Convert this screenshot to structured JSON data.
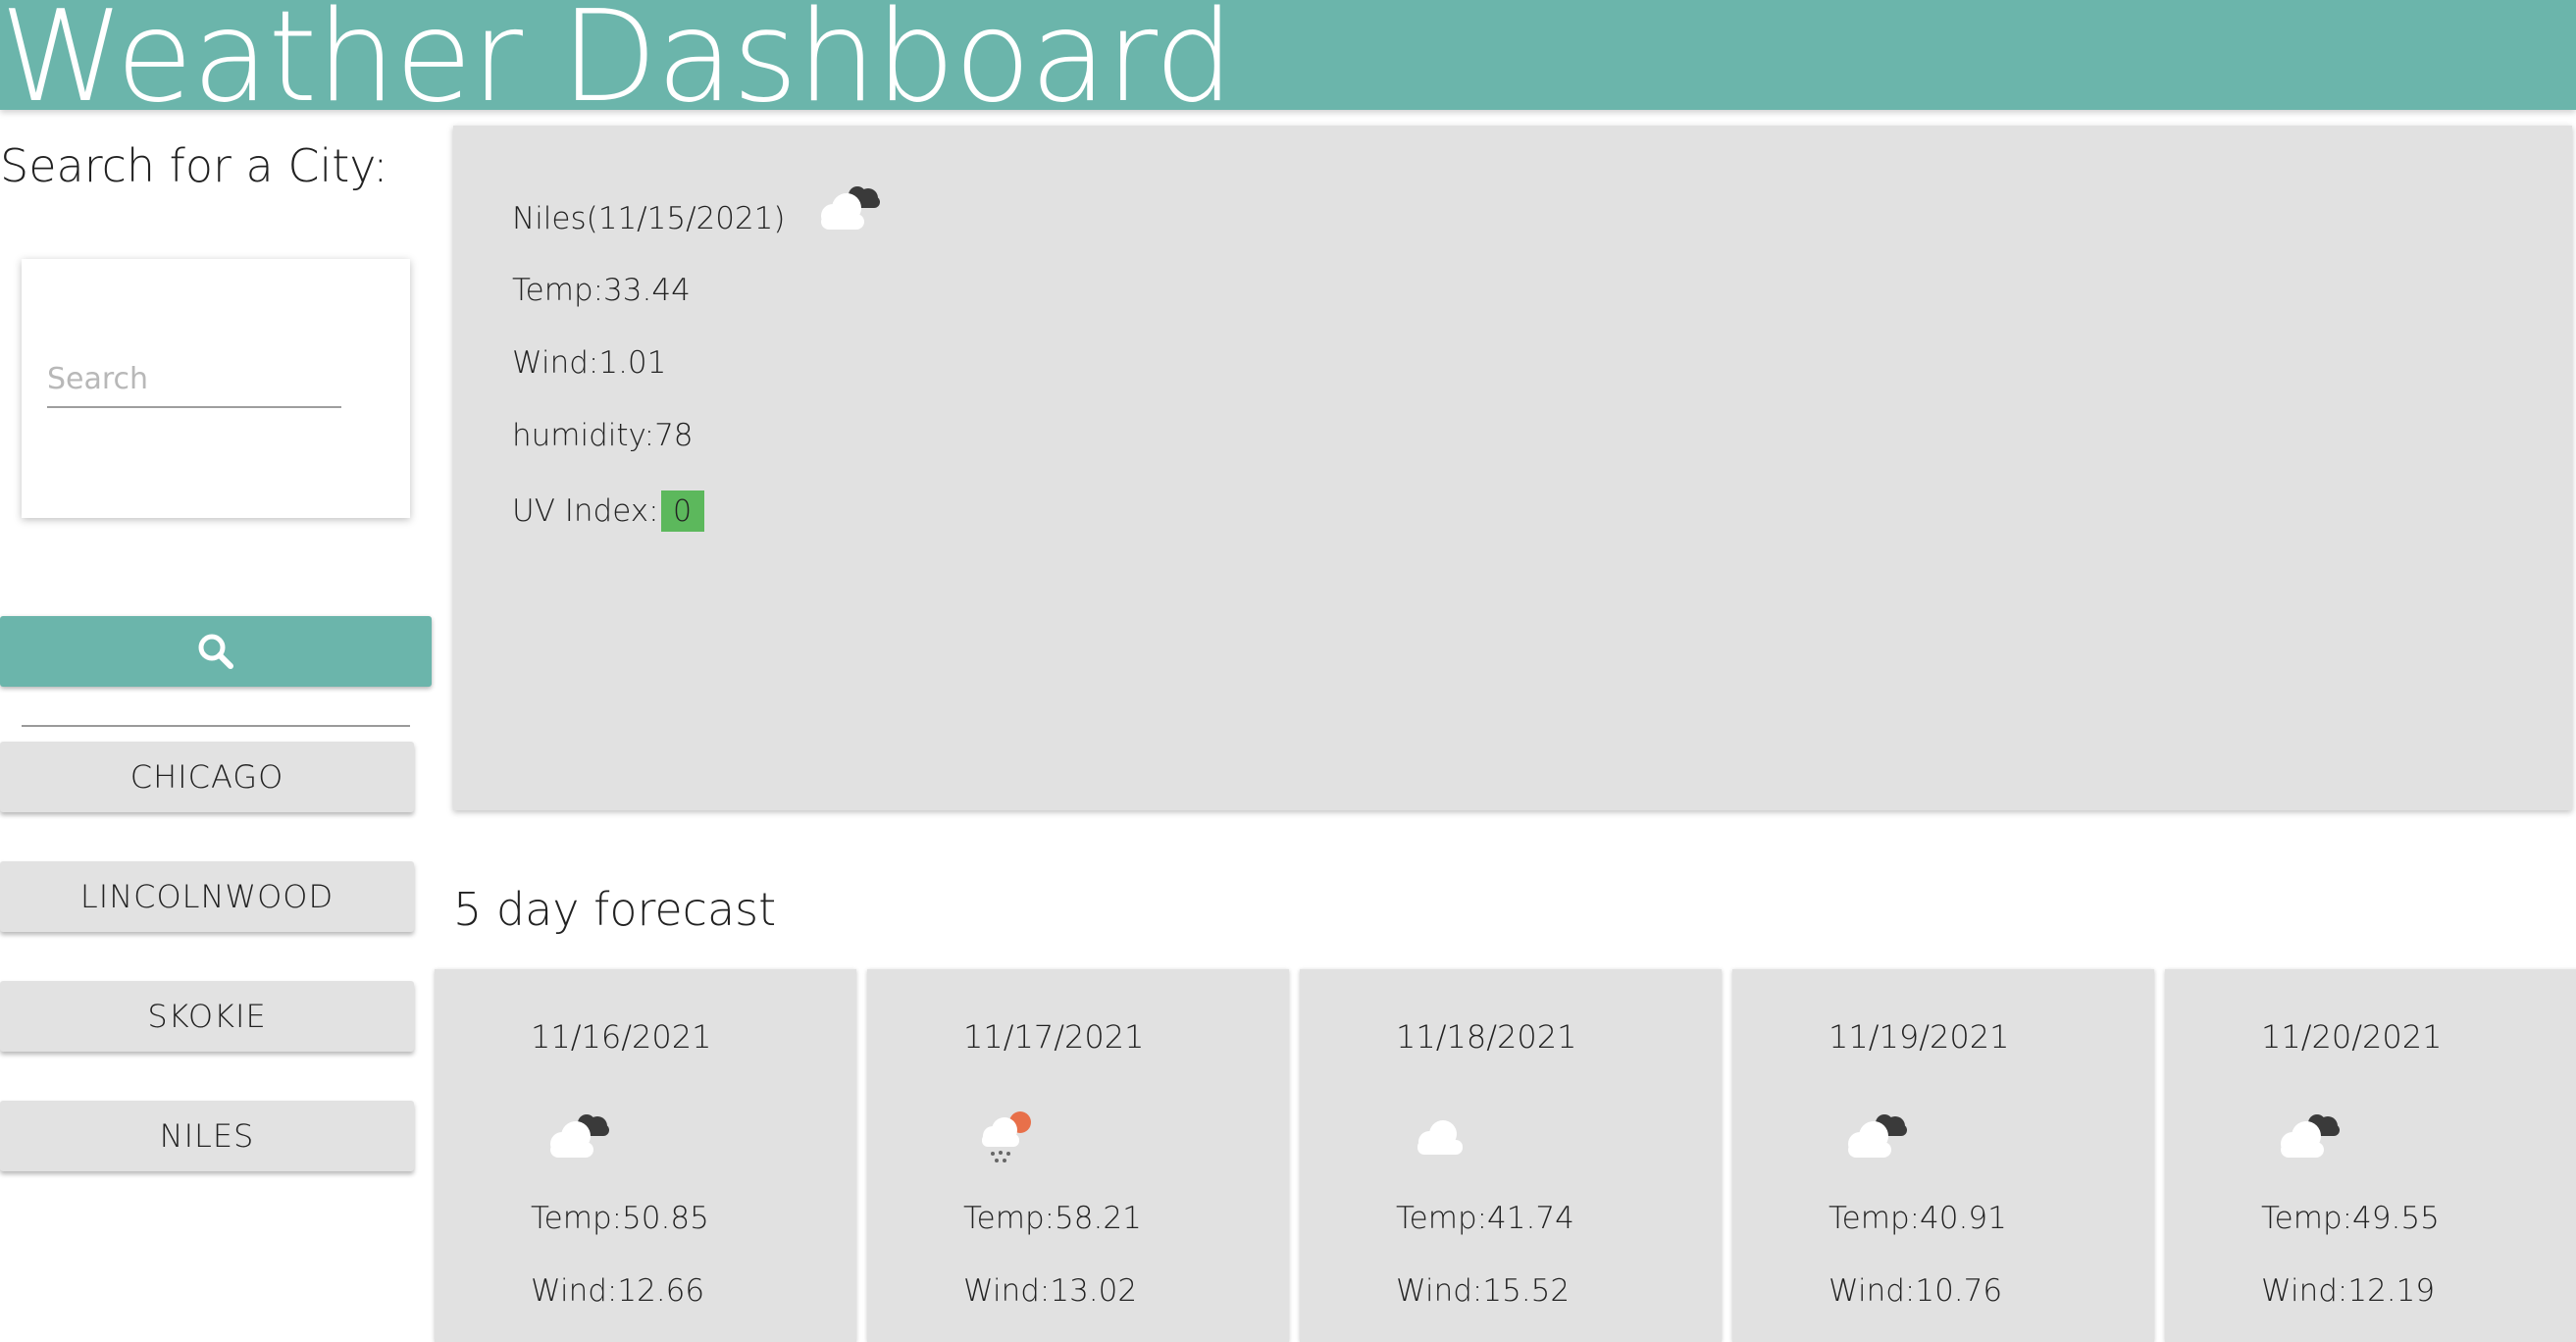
{
  "header": {
    "title": "Weather Dashboard"
  },
  "sidebar": {
    "heading": "Search for a City:",
    "search": {
      "placeholder": "Search",
      "value": ""
    },
    "search_button_icon": "search-icon",
    "history": [
      "CHICAGO",
      "LINCOLNWOOD",
      "SKOKIE",
      "NILES"
    ]
  },
  "current": {
    "title": "Niles(11/15/2021)",
    "icon": "cloud-dark-icon",
    "temp": "Temp:33.44",
    "wind": "Wind:1.01",
    "humidity": "humidity:78",
    "uv_label": "UV Index:",
    "uv_value": "0",
    "uv_color": "#5cb85c"
  },
  "forecast": {
    "title": "5 day forecast",
    "days": [
      {
        "date": "11/16/2021",
        "icon": "cloud-dark-icon",
        "temp": "Temp:50.85",
        "wind": "Wind:12.66"
      },
      {
        "date": "11/17/2021",
        "icon": "cloud-rain-sun-icon",
        "temp": "Temp:58.21",
        "wind": "Wind:13.02"
      },
      {
        "date": "11/18/2021",
        "icon": "cloud-icon",
        "temp": "Temp:41.74",
        "wind": "Wind:15.52"
      },
      {
        "date": "11/19/2021",
        "icon": "cloud-dark-icon",
        "temp": "Temp:40.91",
        "wind": "Wind:10.76"
      },
      {
        "date": "11/20/2021",
        "icon": "cloud-dark-icon",
        "temp": "Temp:49.55",
        "wind": "Wind:12.19"
      }
    ]
  },
  "colors": {
    "accent": "#6bb5ab",
    "card": "#e1e1e1",
    "uv_good": "#5cb85c"
  }
}
